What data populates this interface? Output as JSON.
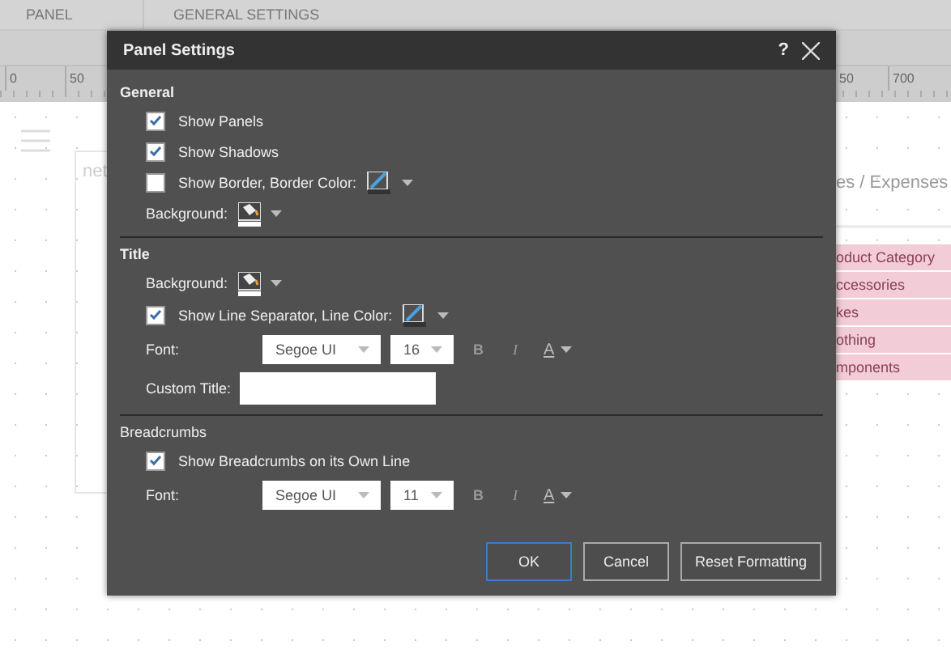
{
  "app": {
    "tabs": [
      {
        "label": "PANEL"
      },
      {
        "label": "GENERAL SETTINGS"
      }
    ]
  },
  "ruler": {
    "labels": [
      "0",
      "50",
      "50",
      "700"
    ]
  },
  "canvas": {
    "panel_fragment": "net",
    "right_title": "es / Expenses",
    "table_rows": [
      "oduct Category",
      "ccessories",
      "kes",
      "othing",
      "mponents"
    ]
  },
  "dialog": {
    "title": "Panel Settings",
    "help": "?",
    "sections": [
      {
        "heading": "General",
        "rows": [
          {
            "kind": "checkbox",
            "label": "Show Panels",
            "checked": true
          },
          {
            "kind": "checkbox",
            "label": "Show Shadows",
            "checked": true
          },
          {
            "kind": "checkbox-color",
            "label": "Show Border, Border Color:",
            "checked": false
          },
          {
            "kind": "fill",
            "label": "Background:"
          }
        ]
      },
      {
        "heading": "Title",
        "rows": [
          {
            "kind": "fill",
            "label": "Background:"
          },
          {
            "kind": "checkbox-color",
            "label": "Show Line Separator, Line Color:",
            "checked": true
          },
          {
            "kind": "font",
            "label": "Font:",
            "font": "Segoe UI",
            "size": "16",
            "bold": "B",
            "italic": "I",
            "color_button": "A"
          },
          {
            "kind": "text",
            "label": "Custom Title:"
          }
        ]
      },
      {
        "heading": "Breadcrumbs",
        "rows": [
          {
            "kind": "checkbox",
            "label": "Show Breadcrumbs on its Own Line",
            "checked": true
          },
          {
            "kind": "font",
            "label": "Font:",
            "font": "Segoe UI",
            "size": "11",
            "bold": "B",
            "italic": "I",
            "color_button": "A"
          }
        ]
      }
    ],
    "buttons": [
      {
        "label": "OK",
        "default": true
      },
      {
        "label": "Cancel",
        "default": false
      },
      {
        "label": "Reset Formatting",
        "default": false
      }
    ]
  }
}
